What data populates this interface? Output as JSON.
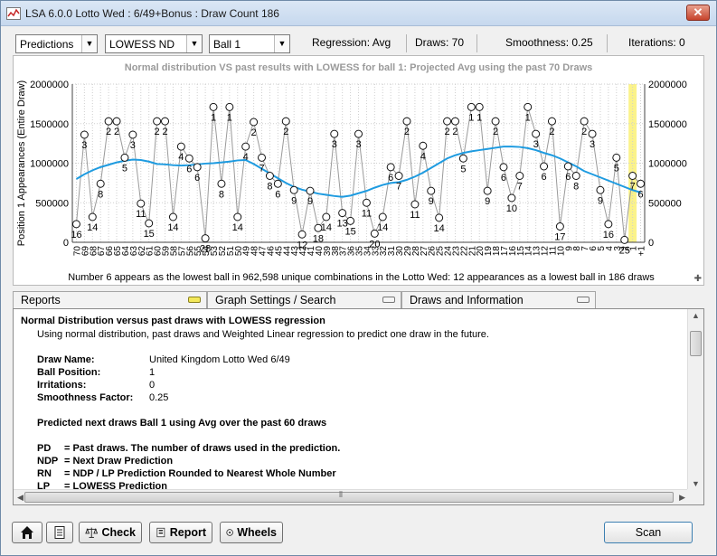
{
  "window": {
    "title": "LSA 6.0.0 Lotto Wed : 6/49+Bonus : Draw Count 186",
    "close_label": "✕"
  },
  "toolbar": {
    "mode_select": "Predictions",
    "method_select": "LOWESS ND",
    "ball_select": "Ball 1",
    "regression": "Regression: Avg",
    "draws": "Draws: 70",
    "smoothness": "Smoothness: 0.25",
    "iterations": "Iterations: 0"
  },
  "chart_data": {
    "type": "line",
    "title": "Normal distribution VS past results with LOWESS for ball 1: Projected Avg using the past 70 Draws",
    "ylabel": "Position 1 Appearances (Entire Draw)",
    "footer": "Number 6 appears as the lowest ball in 962,598 unique combinations in the Lotto Wed: 12 appearances as a lowest ball in 186 draws",
    "ylim": [
      0,
      2000000
    ],
    "y_ticks": [
      "0",
      "500000",
      "1000000",
      "1500000",
      "2000000"
    ],
    "x_ticks": [
      "70",
      "69",
      "68",
      "67",
      "66",
      "65",
      "64",
      "63",
      "62",
      "61",
      "60",
      "59",
      "58",
      "57",
      "56",
      "55",
      "54",
      "53",
      "52",
      "51",
      "50",
      "49",
      "48",
      "47",
      "46",
      "45",
      "44",
      "43",
      "42",
      "41",
      "40",
      "39",
      "38",
      "37",
      "36",
      "35",
      "34",
      "33",
      "32",
      "31",
      "30",
      "29",
      "28",
      "27",
      "26",
      "25",
      "24",
      "23",
      "22",
      "21",
      "20",
      "19",
      "18",
      "17",
      "16",
      "15",
      "14",
      "13",
      "12",
      "11",
      "10",
      "9",
      "8",
      "7",
      "6",
      "5",
      "4",
      "3",
      "2",
      "1",
      "+1"
    ],
    "series": [
      {
        "name": "Past draws",
        "color": "#9a9a9a",
        "balls": [
          16,
          3,
          14,
          8,
          2,
          2,
          5,
          3,
          11,
          15,
          2,
          2,
          14,
          4,
          6,
          6,
          28,
          1,
          8,
          1,
          14,
          4,
          2,
          7,
          8,
          6,
          2,
          9,
          12,
          9,
          18,
          14,
          3,
          13,
          15,
          3,
          11,
          20,
          14,
          6,
          7,
          2,
          11,
          4,
          9,
          14,
          2,
          2,
          5,
          1,
          1,
          9,
          2,
          6,
          10,
          7,
          1,
          3,
          6,
          2,
          17,
          6,
          8,
          2,
          3,
          9,
          16,
          5,
          25,
          7,
          6
        ],
        "values": [
          230000,
          1360000,
          320000,
          740000,
          1530000,
          1530000,
          1070000,
          1360000,
          490000,
          240000,
          1530000,
          1530000,
          320000,
          1210000,
          1060000,
          950000,
          50000,
          1710000,
          740000,
          1710000,
          320000,
          1210000,
          1520000,
          1070000,
          840000,
          740000,
          1530000,
          660000,
          100000,
          650000,
          180000,
          320000,
          1370000,
          370000,
          270000,
          1370000,
          500000,
          110000,
          320000,
          950000,
          840000,
          1530000,
          480000,
          1220000,
          650000,
          310000,
          1530000,
          1530000,
          1060000,
          1710000,
          1710000,
          650000,
          1530000,
          950000,
          560000,
          840000,
          1710000,
          1370000,
          960000,
          1530000,
          200000,
          960000,
          840000,
          1530000,
          1370000,
          660000,
          230000,
          1070000,
          30000,
          840000,
          740000
        ]
      },
      {
        "name": "LOWESS",
        "color": "#1e9be0",
        "values": [
          800000,
          860000,
          910000,
          950000,
          980000,
          1010000,
          1030000,
          1045000,
          1040000,
          1020000,
          990000,
          985000,
          975000,
          970000,
          975000,
          985000,
          995000,
          1000000,
          1010000,
          1020000,
          1035000,
          1040000,
          990000,
          930000,
          870000,
          810000,
          750000,
          700000,
          665000,
          640000,
          615000,
          600000,
          585000,
          575000,
          590000,
          620000,
          650000,
          690000,
          725000,
          750000,
          760000,
          790000,
          830000,
          880000,
          940000,
          1000000,
          1060000,
          1100000,
          1130000,
          1150000,
          1165000,
          1180000,
          1195000,
          1210000,
          1210000,
          1205000,
          1190000,
          1165000,
          1130000,
          1100000,
          1060000,
          1010000,
          960000,
          900000,
          860000,
          820000,
          780000,
          740000,
          700000,
          660000,
          630000
        ]
      }
    ],
    "highlight_last": true
  },
  "tabs": [
    {
      "label": "Reports"
    },
    {
      "label": "Graph Settings / Search"
    },
    {
      "label": "Draws and Information"
    }
  ],
  "report": {
    "heading": "Normal Distribution versus past draws with LOWESS regression",
    "subheading": "Using normal distribution, past draws and Weighted Linear regression to predict one draw in the future.",
    "fields": [
      {
        "label": "Draw Name:",
        "value": "United Kingdom Lotto Wed 6/49"
      },
      {
        "label": "Ball Position:",
        "value": "1"
      },
      {
        "label": "Irritations:",
        "value": "0"
      },
      {
        "label": "Smoothness Factor:",
        "value": "0.25"
      }
    ],
    "predicted": "Predicted next draws Ball 1 using Avg over the past 60 draws",
    "legend": [
      {
        "abbr": "PD",
        "text": "= Past draws. The number of draws used in the prediction."
      },
      {
        "abbr": "NDP",
        "text": "= Next Draw Prediction"
      },
      {
        "abbr": "RN",
        "text": "= NDP / LP Prediction Rounded to Nearest Whole Number"
      },
      {
        "abbr": "LP",
        "text": "= LOWESS Prediction"
      }
    ]
  },
  "bottom": {
    "check_label": "Check",
    "report_label": "Report",
    "wheels_label": "Wheels",
    "scan_label": "Scan"
  }
}
